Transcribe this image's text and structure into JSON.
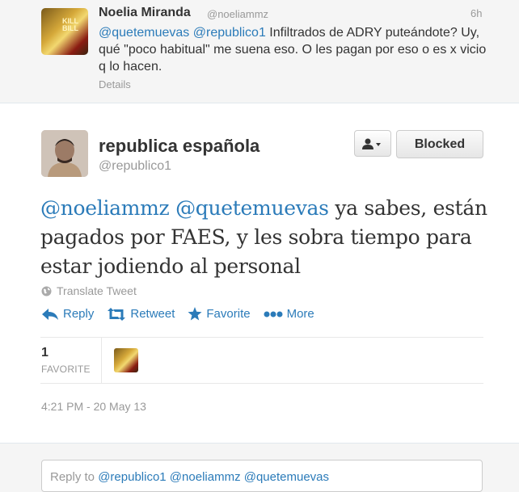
{
  "parent_tweet": {
    "name": "Noelia Miranda",
    "handle": "@noeliammz",
    "time": "6h",
    "mention1": "@quetemuevas",
    "mention2": "@republico1",
    "text": " Infiltrados de ADRY puteándote? Uy, qué \"poco habitual\" me suena eso. O les pagan por eso o es x vicio q lo hacen.",
    "details": "Details",
    "avatar_text": "KILL BILL"
  },
  "main_tweet": {
    "name": "republica española",
    "handle": "@republico1",
    "blocked_label": "Blocked",
    "mention1": "@noeliammz",
    "mention2": "@quetemuevas",
    "text": " ya sabes, están pagados por FAES, y les sobra tiempo para estar jodiendo al personal",
    "translate": "Translate Tweet",
    "actions": {
      "reply": "Reply",
      "retweet": "Retweet",
      "favorite": "Favorite",
      "more": "More"
    },
    "favorites_count": "1",
    "favorites_label": "FAVORITE",
    "timestamp": "4:21 PM - 20 May 13"
  },
  "reply_box": {
    "prefix": "Reply to ",
    "mentions": "@republico1 @noeliammz @quetemuevas"
  },
  "colors": {
    "link": "#2b7bb9",
    "muted": "#999999",
    "text": "#333333"
  },
  "icons": [
    "person-dropdown-icon",
    "globe-icon",
    "reply-icon",
    "retweet-icon",
    "star-icon",
    "more-dots-icon"
  ]
}
